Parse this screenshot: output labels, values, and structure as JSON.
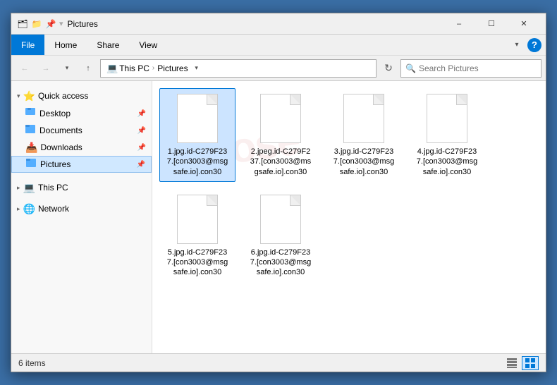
{
  "window": {
    "title": "Pictures",
    "minimize_label": "–",
    "maximize_label": "☐",
    "close_label": "✕"
  },
  "titlebar": {
    "icons": [
      "🗂",
      "📁",
      "⬆"
    ],
    "title": "Pictures"
  },
  "menu": {
    "items": [
      "File",
      "Home",
      "Share",
      "View"
    ],
    "active": "File"
  },
  "addressbar": {
    "back_label": "←",
    "forward_label": "→",
    "dropdown_label": "▾",
    "up_label": "↑",
    "refresh_label": "⟳",
    "path": [
      "This PC",
      "Pictures"
    ],
    "search_placeholder": "Search Pictures"
  },
  "sidebar": {
    "quick_access_label": "Quick access",
    "items": [
      {
        "label": "Desktop",
        "pinned": true,
        "icon": "📁",
        "indent": 1
      },
      {
        "label": "Documents",
        "pinned": true,
        "icon": "📄",
        "indent": 1
      },
      {
        "label": "Downloads",
        "pinned": true,
        "icon": "📥",
        "indent": 1
      },
      {
        "label": "Pictures",
        "pinned": true,
        "icon": "🗂",
        "indent": 1,
        "active": true
      },
      {
        "label": "This PC",
        "icon": "💻",
        "indent": 0
      },
      {
        "label": "Network",
        "icon": "🌐",
        "indent": 0
      }
    ]
  },
  "files": [
    {
      "name": "1.jpg.id-C279F23\n7.[con3003@msg\nsafe.io].con30"
    },
    {
      "name": "2.jpeg.id-C279F2\n37.[con3003@ms\ngsafe.io].con30"
    },
    {
      "name": "3.jpg.id-C279F23\n7.[con3003@msg\nsafe.io].con30"
    },
    {
      "name": "4.jpg.id-C279F23\n7.[con3003@msg\nsafe.io].con30"
    },
    {
      "name": "5.jpg.id-C279F23\n7.[con3003@msg\nsafe.io].con30"
    },
    {
      "name": "6.jpg.id-C279F23\n7.[con3003@msg\nsafe.io].con30"
    }
  ],
  "statusbar": {
    "count_label": "6 items"
  }
}
